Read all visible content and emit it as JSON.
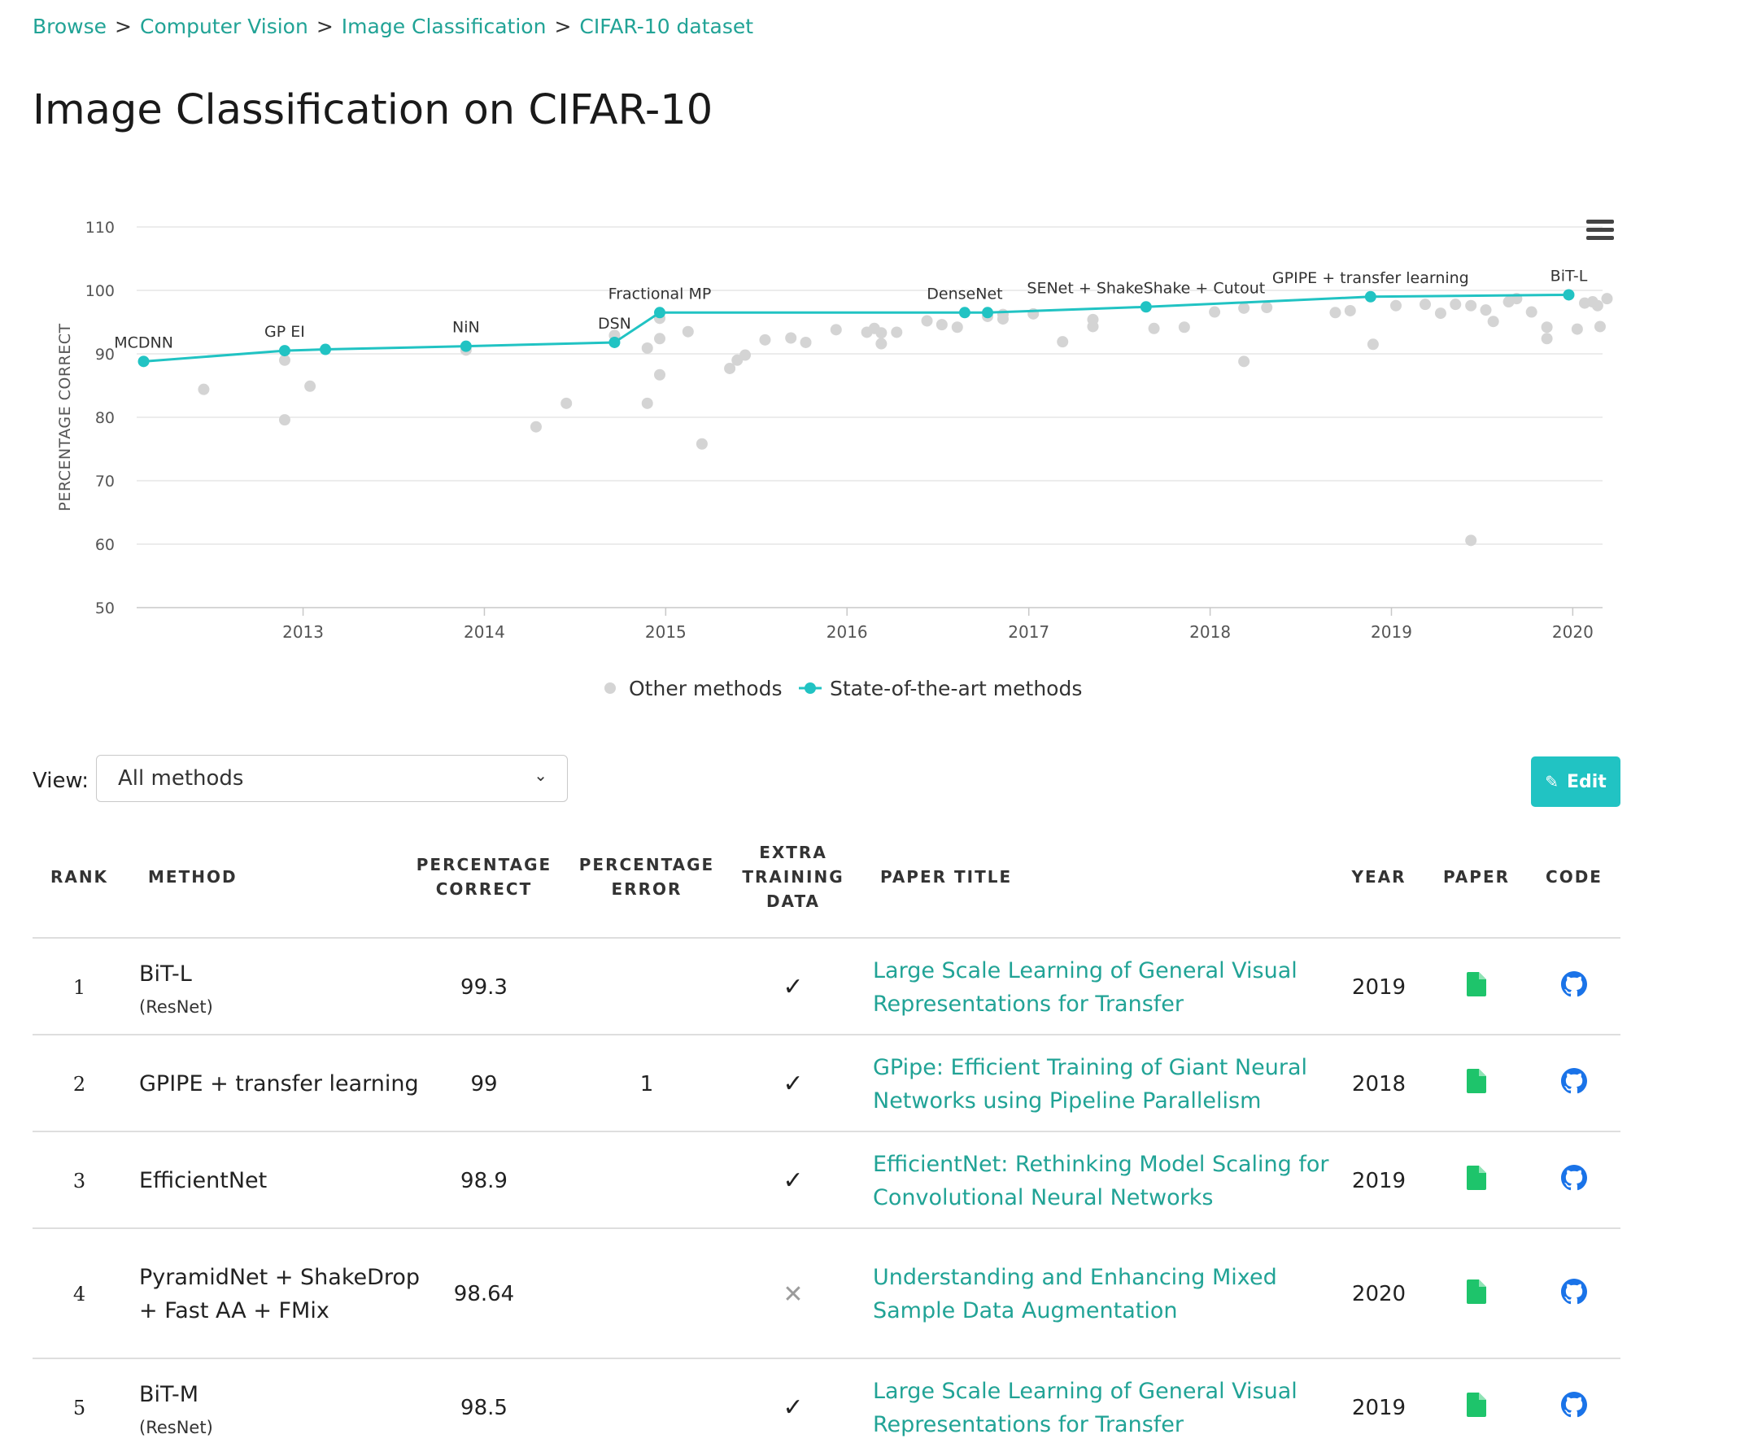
{
  "breadcrumb": {
    "items": [
      "Browse",
      "Computer Vision",
      "Image Classification",
      "CIFAR-10 dataset"
    ],
    "separator": ">"
  },
  "page_title": "Image Classification on CIFAR-10",
  "colors": {
    "accent": "#21a396",
    "sota": "#21c3c3",
    "other": "#d4d4d4",
    "paper_icon": "#1ec46b",
    "code_icon": "#1a73e8"
  },
  "chart_data": {
    "type": "scatter",
    "ylabel": "PERCENTAGE CORRECT",
    "ylim": [
      50,
      110
    ],
    "yticks": [
      50,
      60,
      70,
      80,
      90,
      100,
      110
    ],
    "xlim": [
      "2012-02-01",
      "2020-03-01"
    ],
    "xticks": [
      "2013",
      "2014",
      "2015",
      "2016",
      "2017",
      "2018",
      "2019",
      "2020"
    ],
    "grid": true,
    "legend": {
      "placement": "bottom",
      "entries": [
        "Other methods",
        "State-of-the-art methods"
      ]
    },
    "series": [
      {
        "name": "State-of-the-art methods",
        "points": [
          {
            "x": "2012-02-15",
            "y": 88.8,
            "label": "MCDNN"
          },
          {
            "x": "2012-11-25",
            "y": 90.5,
            "label": "GP EI"
          },
          {
            "x": "2013-02-15",
            "y": 90.7,
            "label": ""
          },
          {
            "x": "2013-11-25",
            "y": 91.2,
            "label": "NiN"
          },
          {
            "x": "2014-09-20",
            "y": 91.8,
            "label": "DSN"
          },
          {
            "x": "2014-12-20",
            "y": 96.5,
            "label": "Fractional MP"
          },
          {
            "x": "2016-08-25",
            "y": 96.5,
            "label": "DenseNet"
          },
          {
            "x": "2016-10-10",
            "y": 96.5,
            "label": ""
          },
          {
            "x": "2017-08-25",
            "y": 97.4,
            "label": "SENet + ShakeShake + Cutout"
          },
          {
            "x": "2018-11-20",
            "y": 99.0,
            "label": "GPIPE + transfer learning"
          },
          {
            "x": "2019-12-24",
            "y": 99.3,
            "label": "BiT-L"
          }
        ]
      },
      {
        "name": "Other methods",
        "points": [
          {
            "x": "2012-06-15",
            "y": 84.4
          },
          {
            "x": "2012-11-25",
            "y": 79.6
          },
          {
            "x": "2012-11-25",
            "y": 89.0
          },
          {
            "x": "2013-01-15",
            "y": 84.9
          },
          {
            "x": "2013-11-25",
            "y": 90.6
          },
          {
            "x": "2014-04-15",
            "y": 78.5
          },
          {
            "x": "2014-06-15",
            "y": 82.2
          },
          {
            "x": "2014-09-20",
            "y": 92.9
          },
          {
            "x": "2014-11-25",
            "y": 90.9
          },
          {
            "x": "2014-11-25",
            "y": 82.2
          },
          {
            "x": "2014-12-20",
            "y": 86.7
          },
          {
            "x": "2014-12-20",
            "y": 92.4
          },
          {
            "x": "2014-12-20",
            "y": 95.6
          },
          {
            "x": "2015-02-15",
            "y": 93.5
          },
          {
            "x": "2015-03-15",
            "y": 75.8
          },
          {
            "x": "2015-05-10",
            "y": 87.7
          },
          {
            "x": "2015-05-25",
            "y": 89.0
          },
          {
            "x": "2015-06-10",
            "y": 89.8
          },
          {
            "x": "2015-07-20",
            "y": 92.2
          },
          {
            "x": "2015-09-10",
            "y": 92.5
          },
          {
            "x": "2015-10-10",
            "y": 91.8
          },
          {
            "x": "2015-12-10",
            "y": 93.8
          },
          {
            "x": "2016-02-10",
            "y": 93.4
          },
          {
            "x": "2016-02-25",
            "y": 94.0
          },
          {
            "x": "2016-03-10",
            "y": 93.3
          },
          {
            "x": "2016-03-10",
            "y": 91.6
          },
          {
            "x": "2016-04-10",
            "y": 93.4
          },
          {
            "x": "2016-06-10",
            "y": 95.2
          },
          {
            "x": "2016-07-10",
            "y": 94.6
          },
          {
            "x": "2016-08-10",
            "y": 94.2
          },
          {
            "x": "2016-10-10",
            "y": 95.9
          },
          {
            "x": "2016-11-10",
            "y": 95.5
          },
          {
            "x": "2016-11-10",
            "y": 96.2
          },
          {
            "x": "2017-01-10",
            "y": 96.3
          },
          {
            "x": "2017-03-10",
            "y": 91.9
          },
          {
            "x": "2017-05-10",
            "y": 95.4
          },
          {
            "x": "2017-05-10",
            "y": 94.3
          },
          {
            "x": "2017-09-10",
            "y": 94.0
          },
          {
            "x": "2017-11-10",
            "y": 94.2
          },
          {
            "x": "2018-01-10",
            "y": 96.6
          },
          {
            "x": "2018-03-10",
            "y": 88.8
          },
          {
            "x": "2018-03-10",
            "y": 97.2
          },
          {
            "x": "2018-04-25",
            "y": 97.3
          },
          {
            "x": "2018-09-10",
            "y": 96.5
          },
          {
            "x": "2018-10-10",
            "y": 96.8
          },
          {
            "x": "2018-11-25",
            "y": 91.5
          },
          {
            "x": "2019-01-10",
            "y": 97.6
          },
          {
            "x": "2019-03-10",
            "y": 97.8
          },
          {
            "x": "2019-04-10",
            "y": 96.4
          },
          {
            "x": "2019-05-10",
            "y": 97.8
          },
          {
            "x": "2019-06-10",
            "y": 60.6
          },
          {
            "x": "2019-06-10",
            "y": 97.6
          },
          {
            "x": "2019-07-10",
            "y": 96.9
          },
          {
            "x": "2019-07-25",
            "y": 95.1
          },
          {
            "x": "2019-08-25",
            "y": 98.2
          },
          {
            "x": "2019-09-10",
            "y": 98.7
          },
          {
            "x": "2019-10-10",
            "y": 96.6
          },
          {
            "x": "2019-11-10",
            "y": 94.2
          },
          {
            "x": "2019-11-10",
            "y": 92.4
          },
          {
            "x": "2020-01-10",
            "y": 93.9
          },
          {
            "x": "2020-01-25",
            "y": 98.0
          },
          {
            "x": "2020-02-10",
            "y": 98.2
          },
          {
            "x": "2020-02-20",
            "y": 97.6
          },
          {
            "x": "2020-02-25",
            "y": 94.3
          },
          {
            "x": "2020-03-10",
            "y": 98.7
          }
        ]
      }
    ]
  },
  "view": {
    "label": "View:",
    "selected": "All methods"
  },
  "edit_button": {
    "label": "Edit"
  },
  "table": {
    "headers": {
      "rank": "RANK",
      "method": "METHOD",
      "pct_correct": [
        "PERCENTAGE",
        "CORRECT"
      ],
      "pct_error": [
        "PERCENTAGE",
        "ERROR"
      ],
      "extra_data": [
        "EXTRA",
        "TRAINING",
        "DATA"
      ],
      "paper_title": "PAPER TITLE",
      "year": "YEAR",
      "paper": "PAPER",
      "code": "CODE"
    },
    "rows": [
      {
        "rank": "1",
        "method": "BiT-L",
        "method_sub": "(ResNet)",
        "pct_correct": "99.3",
        "pct_error": "",
        "extra_data": "✓",
        "paper_title": "Large Scale Learning of General Visual Representations for Transfer",
        "year": "2019"
      },
      {
        "rank": "2",
        "method": "GPIPE + transfer learning",
        "method_sub": "",
        "pct_correct": "99",
        "pct_error": "1",
        "extra_data": "✓",
        "paper_title": "GPipe: Efficient Training of Giant Neural Networks using Pipeline Parallelism",
        "year": "2018"
      },
      {
        "rank": "3",
        "method": "EfficientNet",
        "method_sub": "",
        "pct_correct": "98.9",
        "pct_error": "",
        "extra_data": "✓",
        "paper_title": "EfficientNet: Rethinking Model Scaling for Convolutional Neural Networks",
        "year": "2019"
      },
      {
        "rank": "4",
        "method": "PyramidNet + ShakeDrop + Fast AA + FMix",
        "method_sub": "",
        "pct_correct": "98.64",
        "pct_error": "",
        "extra_data": "✕",
        "paper_title": "Understanding and Enhancing Mixed Sample Data Augmentation",
        "year": "2020"
      },
      {
        "rank": "5",
        "method": "BiT-M",
        "method_sub": "(ResNet)",
        "pct_correct": "98.5",
        "pct_error": "",
        "extra_data": "✓",
        "paper_title": "Large Scale Learning of General Visual Representations for Transfer",
        "year": "2019"
      }
    ]
  }
}
